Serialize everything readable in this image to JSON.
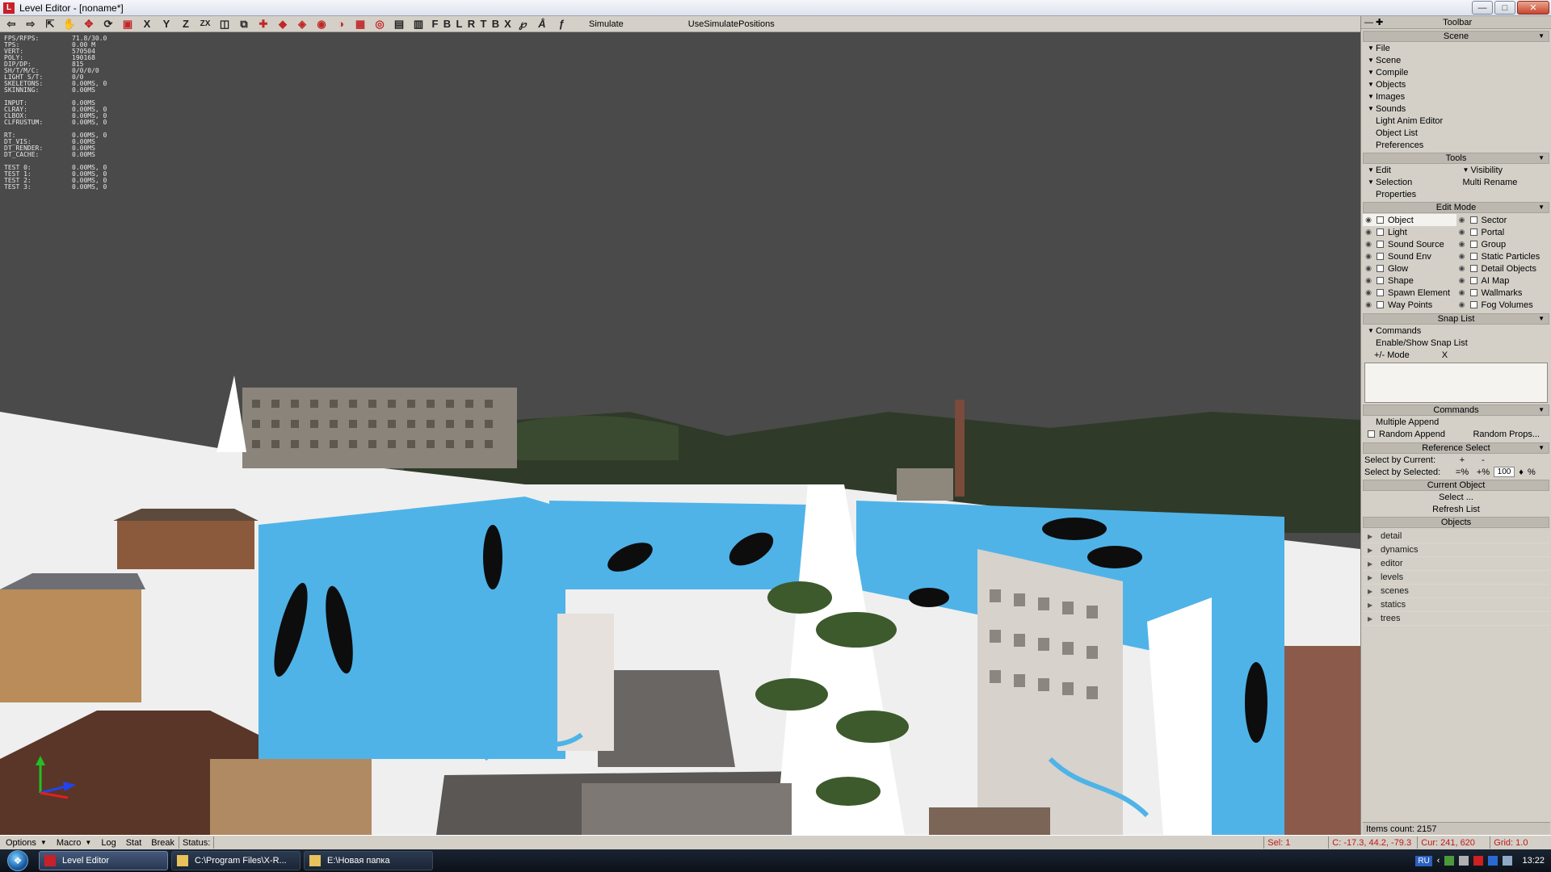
{
  "window": {
    "title": "Level Editor - [noname*]"
  },
  "toolbar": {
    "letters": [
      "X",
      "Y",
      "Z",
      "ZX",
      "F",
      "B",
      "L",
      "R",
      "T",
      "B",
      "X"
    ],
    "simulate": "Simulate",
    "use_simulate_positions": "UseSimulatePositions"
  },
  "stats": [
    [
      "FPS/RFPS:",
      "71.8/30.0"
    ],
    [
      "TPS:",
      "0.00 M"
    ],
    [
      "VERT:",
      "570504"
    ],
    [
      "POLY:",
      "190168"
    ],
    [
      "DIP/DP:",
      "815"
    ],
    [
      "SH/T/M/C:",
      "0/0/0/0"
    ],
    [
      "LIGHT S/T:",
      "0/0"
    ],
    [
      "SKELETONS:",
      "0.00MS, 0"
    ],
    [
      "SKINNING:",
      "0.00MS"
    ],
    null,
    [
      "INPUT:",
      "0.00MS"
    ],
    [
      "CLRAY:",
      "0.00MS, 0"
    ],
    [
      "CLBOX:",
      "0.00MS, 0"
    ],
    [
      "CLFRUSTUM:",
      "0.00MS, 0"
    ],
    null,
    [
      " RT:",
      "0.00MS, 0"
    ],
    [
      " DT_VIS:",
      "0.00MS"
    ],
    [
      " DT_RENDER:",
      "0.00MS"
    ],
    [
      " DT_CACHE:",
      "0.00MS"
    ],
    null,
    [
      "TEST 0:",
      "0.00MS, 0"
    ],
    [
      "TEST 1:",
      "0.00MS, 0"
    ],
    [
      "TEST 2:",
      "0.00MS, 0"
    ],
    [
      "TEST 3:",
      "0.00MS, 0"
    ]
  ],
  "panel": {
    "header": "Toolbar",
    "scene_title": "Scene",
    "scene_items": [
      {
        "label": "File",
        "tri": true
      },
      {
        "label": "Scene",
        "tri": true
      },
      {
        "label": "Compile",
        "tri": true
      },
      {
        "label": "Objects",
        "tri": true
      },
      {
        "label": "Images",
        "tri": true
      },
      {
        "label": "Sounds",
        "tri": true
      },
      {
        "label": "Light Anim Editor",
        "tri": false
      },
      {
        "label": "Object List",
        "tri": false
      },
      {
        "label": "Preferences",
        "tri": false
      }
    ],
    "tools_title": "Tools",
    "tools": {
      "edit": "Edit",
      "visibility": "Visibility",
      "selection": "Selection",
      "multi_rename": "Multi Rename",
      "properties": "Properties"
    },
    "edit_mode_title": "Edit Mode",
    "edit_mode_left": [
      "Object",
      "Light",
      "Sound Source",
      "Sound Env",
      "Glow",
      "Shape",
      "Spawn Element",
      "Way Points"
    ],
    "edit_mode_right": [
      "Sector",
      "Portal",
      "Group",
      "Static Particles",
      "Detail Objects",
      "AI Map",
      "Wallmarks",
      "Fog Volumes"
    ],
    "snap_title": "Snap List",
    "snap_commands": "Commands",
    "snap_enable": "Enable/Show Snap List",
    "snap_mode_toggle": "+/-",
    "snap_mode": "Mode",
    "snap_close": "X",
    "commands_title": "Commands",
    "multiple_append": "Multiple Append",
    "random_append": "Random Append",
    "random_props": "Random Props...",
    "ref_title": "Reference Select",
    "select_by_current": "Select by Current:",
    "select_by_selected": "Select by Selected:",
    "plus": "+",
    "minus": "-",
    "eq_pct": "=%",
    "plus_pct": "+%",
    "pct_value": "100",
    "spin": "♦",
    "pct_sign": "%",
    "current_object_title": "Current Object",
    "select_btn": "Select ...",
    "refresh_list": "Refresh List",
    "objects_title": "Objects",
    "objects": [
      "detail",
      "dynamics",
      "editor",
      "levels",
      "scenes",
      "statics",
      "trees"
    ],
    "items_count": "Items count: 2157"
  },
  "statusbar": {
    "options": "Options",
    "macro": "Macro",
    "log": "Log",
    "stat": "Stat",
    "break": "Break",
    "status": "Status:",
    "sel": "Sel: 1",
    "coords": "C: -17.3, 44.2, -79.3",
    "cur": "Cur: 241, 620",
    "grid": "Grid: 1.0"
  },
  "taskbar": {
    "tasks": [
      "Level Editor",
      "C:\\Program Files\\X-R...",
      "E:\\Новая папка"
    ],
    "lang": "RU",
    "clock": "13:22"
  },
  "colors": {
    "sky": "#4a4a4a",
    "snow": "#f2f2f2",
    "blue_wall": "#4fb3e8",
    "panel_bg": "#d4d0c8",
    "red_status": "#c01818"
  }
}
